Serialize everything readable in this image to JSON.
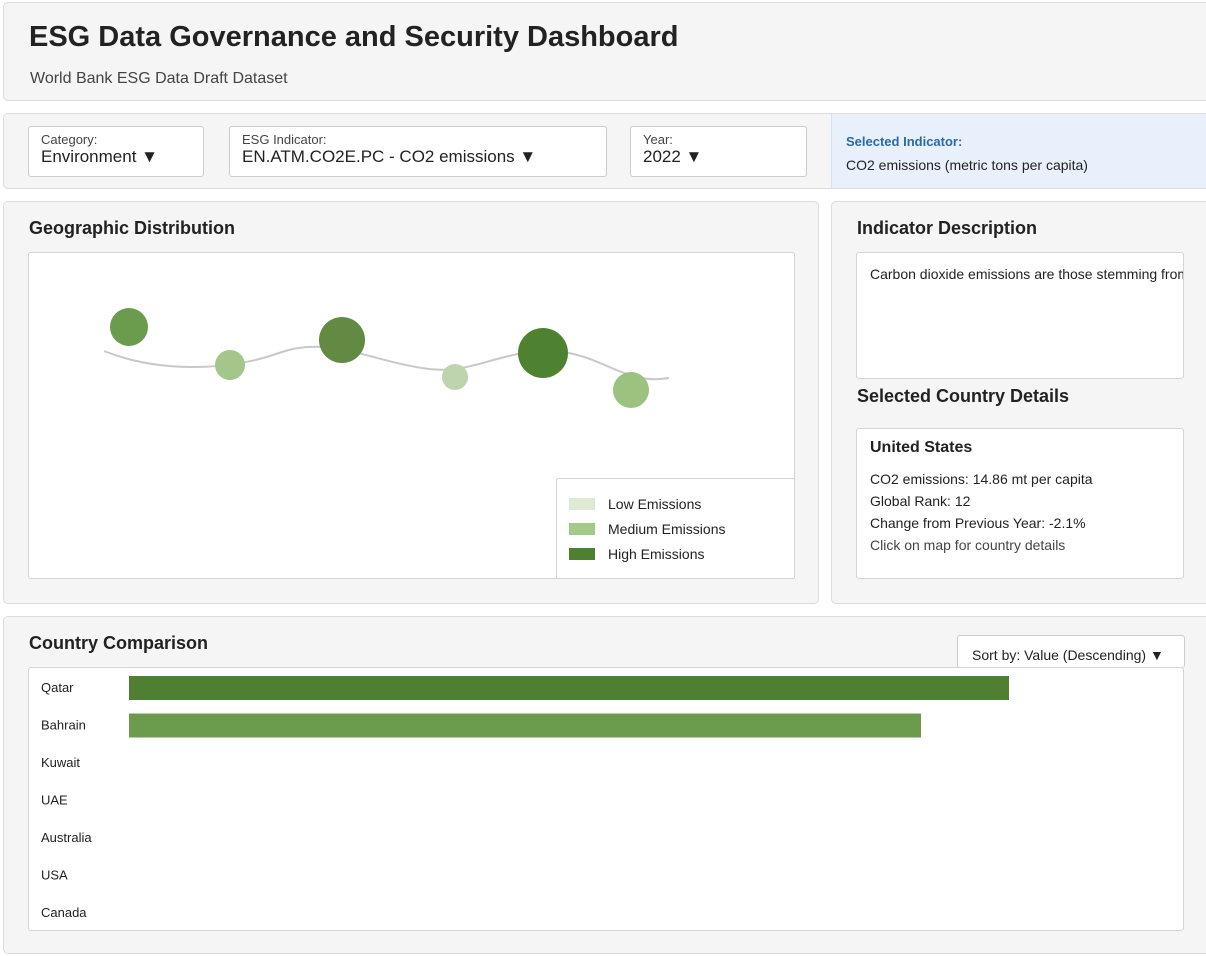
{
  "header": {
    "title": "ESG Data Governance and Security Dashboard",
    "subtitle": "World Bank ESG Data Draft Dataset"
  },
  "filters": {
    "category": {
      "label": "Category:",
      "value": "Environment ▼"
    },
    "indicator": {
      "label": "ESG Indicator:",
      "value": "EN.ATM.CO2E.PC - CO2 emissions ▼"
    },
    "year": {
      "label": "Year:",
      "value": "2022 ▼"
    },
    "selected_indicator": {
      "title": "Selected Indicator:",
      "value": "CO2 emissions (metric tons per capita)"
    }
  },
  "geo": {
    "title": "Geographic Distribution",
    "bubbles": [
      {
        "level": "high",
        "color": "#6b9c4d"
      },
      {
        "level": "medium",
        "color": "#a3c78a"
      },
      {
        "level": "high",
        "color": "#638a43"
      },
      {
        "level": "low",
        "color": "#bdd4ae"
      },
      {
        "level": "high",
        "color": "#4f8230"
      },
      {
        "level": "medium",
        "color": "#9bc27e"
      }
    ],
    "legend": [
      {
        "label": "Low Emissions",
        "color": "#dcebd2"
      },
      {
        "label": "Medium Emissions",
        "color": "#a3ca86"
      },
      {
        "label": "High Emissions",
        "color": "#4f7f31"
      }
    ]
  },
  "description": {
    "title": "Indicator Description",
    "text": "Carbon dioxide emissions are those stemming from"
  },
  "details": {
    "title": "Selected Country Details",
    "country": "United States",
    "emissions": "CO2 emissions: 14.86 mt per capita",
    "rank": "Global Rank: 12",
    "change": "Change from Previous Year: -2.1%",
    "hint": "Click on map for country details"
  },
  "comparison": {
    "title": "Country Comparison",
    "sort_label": "Sort by: Value (Descending) ▼"
  },
  "chart_data": {
    "type": "bar",
    "orientation": "horizontal",
    "categories": [
      "Qatar",
      "Bahrain",
      "Kuwait",
      "UAE",
      "Australia",
      "USA",
      "Canada"
    ],
    "values": [
      1.0,
      0.9,
      null,
      null,
      null,
      null,
      null
    ],
    "colors": [
      "#4f7f31",
      "#6b9c4d"
    ]
  }
}
